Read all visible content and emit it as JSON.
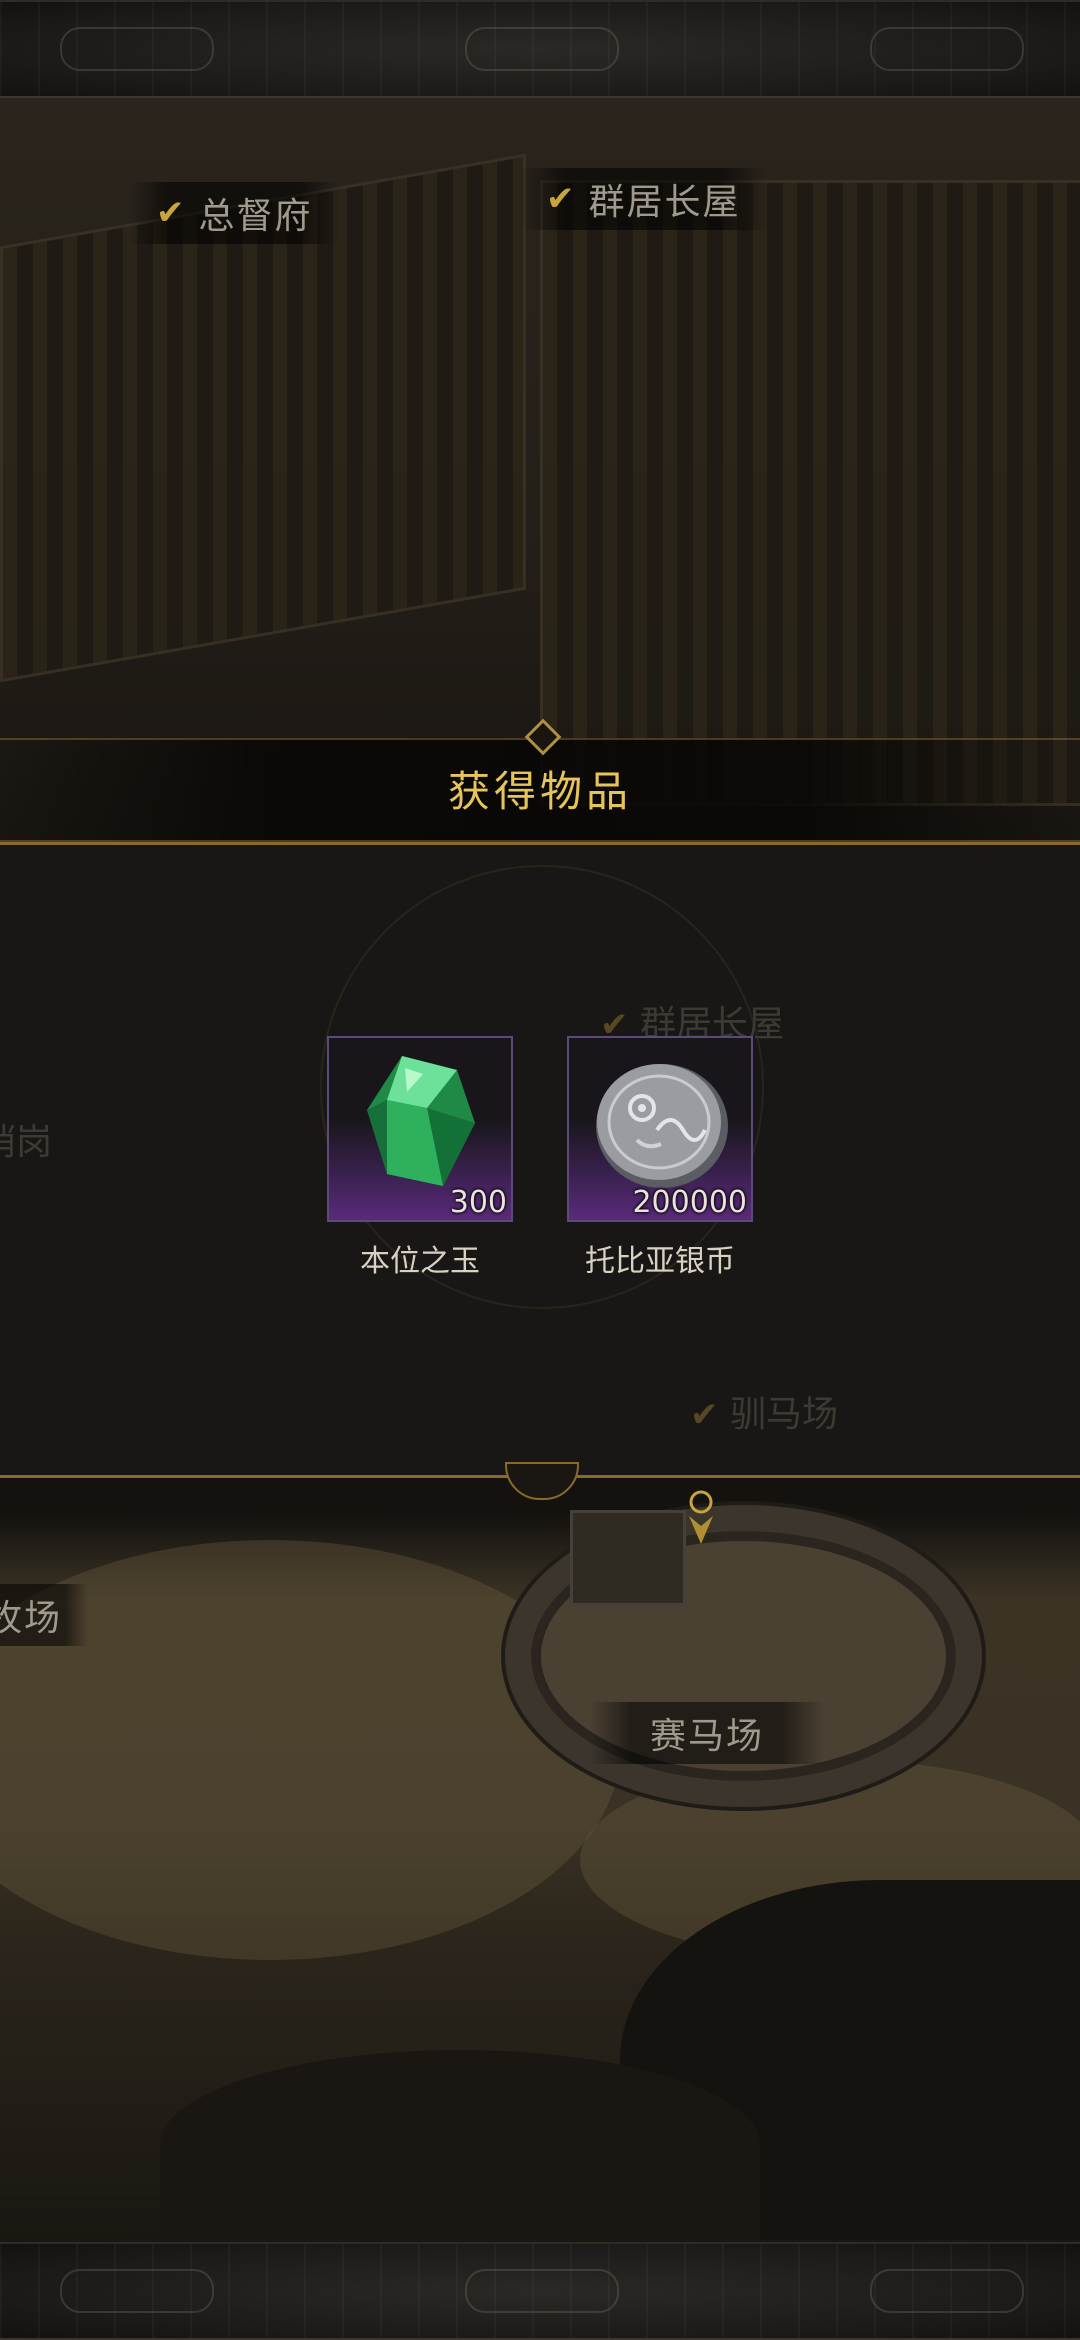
{
  "map_labels": {
    "governor_mansion": "总督府",
    "longhouse_top": "群居长屋",
    "longhouse_faded": "群居长屋",
    "left_faded": "哨岗",
    "horse_training": "驯马场",
    "pasture": "牧场",
    "racecourse": "赛马场"
  },
  "dialog": {
    "title": "获得物品"
  },
  "rewards": [
    {
      "name": "本位之玉",
      "quantity": "300",
      "icon": "green-gem-icon"
    },
    {
      "name": "托比亚银币",
      "quantity": "200000",
      "icon": "silver-coin-icon"
    }
  ],
  "colors": {
    "title_gold": "#e7c45a",
    "panel_border": "#8a6a2c",
    "item_rarity_purple": "#5a2a7a",
    "check_gold": "#c8a43c"
  }
}
